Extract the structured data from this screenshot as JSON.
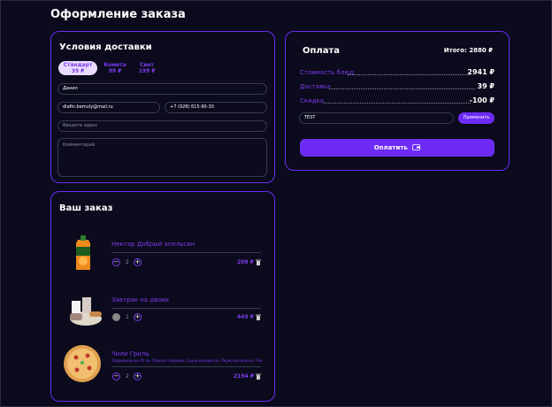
{
  "page_title": "Оформление заказа",
  "delivery": {
    "title": "Условия доставки",
    "tabs": [
      {
        "label": "Стандарт",
        "price": "39 ₽",
        "active": true
      },
      {
        "label": "Комета",
        "price": "99 ₽",
        "active": false
      },
      {
        "label": "Свет",
        "price": "199 ₽",
        "active": false
      }
    ],
    "name_value": "Данил",
    "email_value": "diafin.bemuly@mail.ru",
    "phone_value": "+7 (928) 615-90-30",
    "address_placeholder": "Введите адрес",
    "comment_placeholder": "Комментарий"
  },
  "payment": {
    "title": "Оплата",
    "total_label": "Итого: 2880 ₽",
    "rows": [
      {
        "label": "Стоимость блюд",
        "value": "2941 ₽"
      },
      {
        "label": "Доставка",
        "value": "39 ₽"
      },
      {
        "label": "Скидка",
        "value": "-100 ₽"
      }
    ],
    "promo_value": "TEST",
    "apply_label": "Применить",
    "pay_label": "Оплатить",
    "pay_icon": "wallet-icon"
  },
  "order": {
    "title": "Ваш заказ",
    "items": [
      {
        "name": "Нектар Добрый апельсин",
        "description": "",
        "qty": "2",
        "price": "298 ₽",
        "image": "juice-carton"
      },
      {
        "name": "Завтрак на двоих",
        "description": "",
        "qty": "1",
        "price": "449 ₽",
        "image": "breakfast-set"
      },
      {
        "name": "Чили Гриль",
        "description": "Традиционное 40 см, Пряная говядина, Сыры моцарелла, Перец халапеньо, Пикантная пепперони",
        "qty": "2",
        "price": "2194 ₽",
        "image": "pizza"
      }
    ]
  },
  "colors": {
    "accent": "#6d2bf5",
    "accent_text": "#7c3aed",
    "background": "#0b0b1d",
    "tab_active_bg": "#e9dcff"
  }
}
